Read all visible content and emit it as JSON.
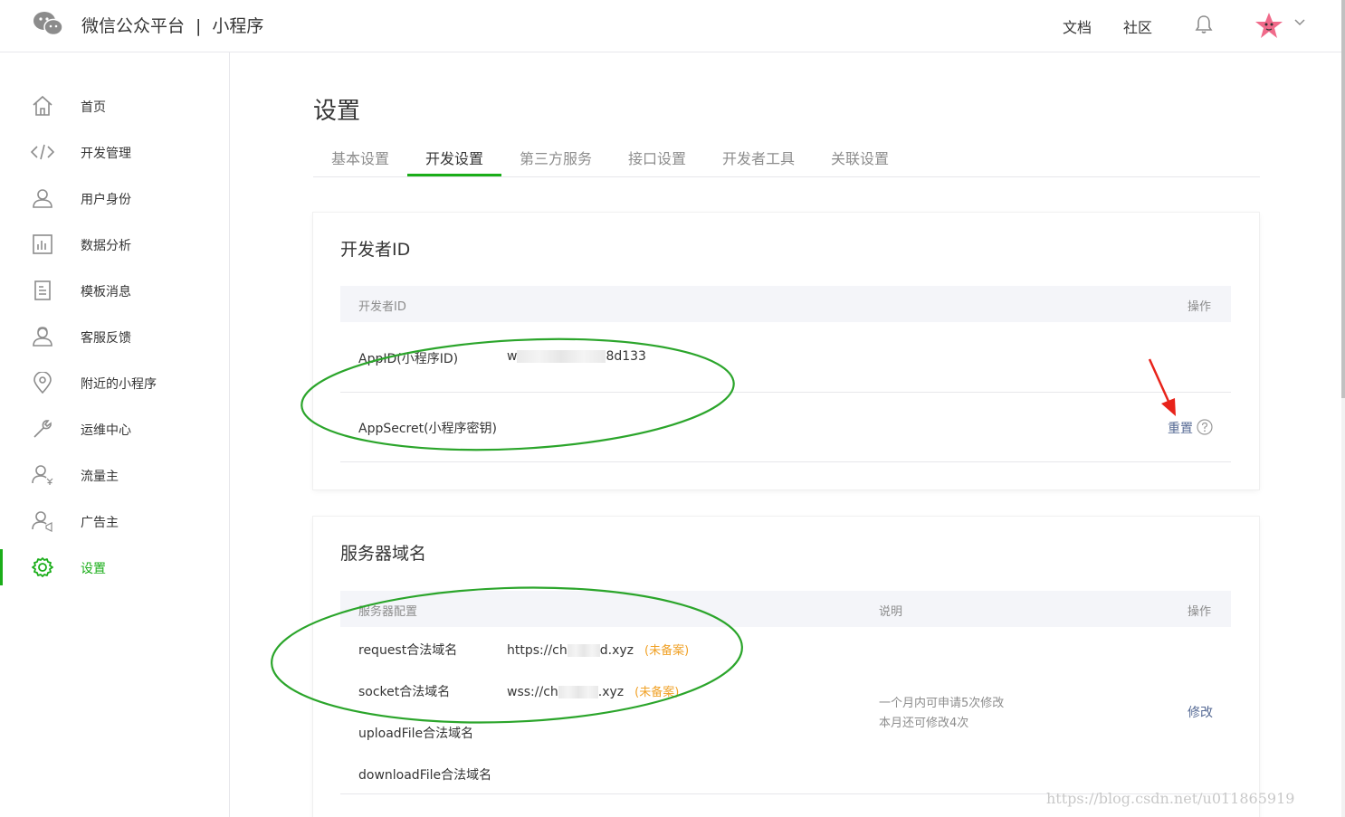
{
  "header": {
    "brand_name": "微信公众平台",
    "brand_sep": "|",
    "brand_product": "小程序",
    "links": [
      "文档",
      "社区"
    ]
  },
  "sidebar": {
    "items": [
      {
        "label": "首页",
        "icon": "home-icon"
      },
      {
        "label": "开发管理",
        "icon": "code-icon"
      },
      {
        "label": "用户身份",
        "icon": "user-icon"
      },
      {
        "label": "数据分析",
        "icon": "chart-icon"
      },
      {
        "label": "模板消息",
        "icon": "document-icon"
      },
      {
        "label": "客服反馈",
        "icon": "customer-service-icon"
      },
      {
        "label": "附近的小程序",
        "icon": "location-pin-icon"
      },
      {
        "label": "运维中心",
        "icon": "wrench-icon"
      },
      {
        "label": "流量主",
        "icon": "user-yen-icon"
      },
      {
        "label": "广告主",
        "icon": "user-ad-icon"
      },
      {
        "label": "设置",
        "icon": "gear-icon",
        "active": true
      }
    ],
    "accent_color": "#1aad19"
  },
  "main": {
    "title": "设置",
    "tabs": [
      {
        "label": "基本设置"
      },
      {
        "label": "开发设置",
        "active": true
      },
      {
        "label": "第三方服务"
      },
      {
        "label": "接口设置"
      },
      {
        "label": "开发者工具"
      },
      {
        "label": "关联设置"
      }
    ]
  },
  "developer_id": {
    "title": "开发者ID",
    "headers": {
      "name": "开发者ID",
      "action": "操作"
    },
    "appid_label": "AppID(小程序ID)",
    "appid_prefix": "w",
    "appid_suffix": "8d133",
    "secret_label": "AppSecret(小程序密钥)",
    "reset_label": "重置"
  },
  "server_domain": {
    "title": "服务器域名",
    "headers": {
      "config": "服务器配置",
      "desc": "说明",
      "action": "操作"
    },
    "rows": [
      {
        "label": "request合法域名",
        "value_prefix": "https://ch",
        "value_suffix": "d.xyz",
        "tag": "(未备案)"
      },
      {
        "label": "socket合法域名",
        "value_prefix": "wss://ch",
        "value_suffix": ".xyz",
        "tag": "(未备案)"
      },
      {
        "label": "uploadFile合法域名"
      },
      {
        "label": "downloadFile合法域名"
      }
    ],
    "desc_line1": "一个月内可申请5次修改",
    "desc_line2": "本月还可修改4次",
    "modify_label": "修改",
    "tag_color": "#f0a126"
  },
  "annotations": {
    "ellipse_color": "#2ba52b",
    "arrow_color": "#e8231a"
  },
  "watermark": "https://blog.csdn.net/u011865919"
}
